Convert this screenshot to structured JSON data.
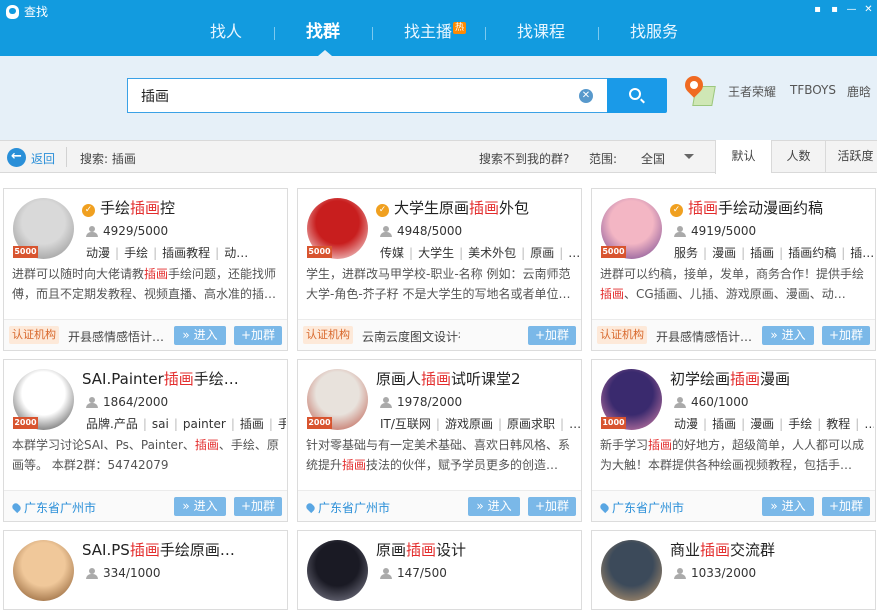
{
  "window": {
    "title": "查找"
  },
  "nav": {
    "tabs": [
      {
        "label": "找人"
      },
      {
        "label": "找群"
      },
      {
        "label": "找主播",
        "badge": "热"
      },
      {
        "label": "找课程"
      },
      {
        "label": "找服务"
      }
    ],
    "active": "找群"
  },
  "search": {
    "query": "插画",
    "clear_icon": "clear-icon",
    "button_icon": "search-icon"
  },
  "hot_words": [
    "王者荣耀",
    "TFBOYS",
    "鹿晗"
  ],
  "filter": {
    "back_label": "返回",
    "search_label": "搜索: 插画",
    "not_found": "搜索不到我的群?",
    "scope_label": "范围:",
    "scope_value": "全国",
    "sort_tabs": [
      "默认",
      "人数",
      "活跃度"
    ],
    "active_sort": "默认"
  },
  "buttons": {
    "enter": "» 进入",
    "join": "+加群",
    "org_badge": "认证机构"
  },
  "groups": [
    {
      "level": "5000",
      "certified": true,
      "title_pre": "手绘",
      "title_hl": "插画",
      "title_post": "控",
      "members": "4929/5000",
      "tags": [
        "动漫",
        "手绘",
        "插画教程",
        "动…"
      ],
      "desc_pre": "进群可以随时向大佬请教",
      "desc_hl": "插画",
      "desc_post": "手绘问题，还能找师傅，而且不定期发教程、视频直播、高水准的插…",
      "footer_type": "org",
      "footer_text": "开县感情感悟计…",
      "avatar_colors": [
        "#d9d9d9",
        "#8a8a8a"
      ]
    },
    {
      "level": "5000",
      "certified": true,
      "title_pre": "大学生原画",
      "title_hl": "插画",
      "title_post": "外包",
      "members": "4948/5000",
      "tags": [
        "传媒",
        "大学生",
        "美术外包",
        "原画",
        "…"
      ],
      "desc_pre": "学生，进群改马甲学校-职业-名称 例如：云南师范大学-角色-芥子籽 不是大学生的写地名或者单位…",
      "desc_hl": "",
      "desc_post": "",
      "footer_type": "org",
      "footer_text": "云南云度图文设计有限公司",
      "avatar_colors": [
        "#c81e1e",
        "#ffffff"
      ]
    },
    {
      "level": "5000",
      "certified": true,
      "title_pre": "",
      "title_hl": "插画",
      "title_post": "手绘动漫画约稿",
      "members": "4919/5000",
      "tags": [
        "服务",
        "漫画",
        "插画",
        "插画约稿",
        "插…"
      ],
      "desc_pre": "进群可以约稿，接单，发单，商务合作！提供手绘",
      "desc_hl": "插画",
      "desc_post": "、CG插画、儿插、游戏原画、漫画、动…",
      "footer_type": "org",
      "footer_text": "开县感情感悟计…",
      "avatar_colors": [
        "#f3b6c4",
        "#6a3d8c"
      ]
    },
    {
      "level": "2000",
      "certified": false,
      "title_pre": "SAI.Painter",
      "title_hl": "插画",
      "title_post": "手绘…",
      "members": "1864/2000",
      "tags": [
        "品牌.产品",
        "sai",
        "painter",
        "插画",
        "手…"
      ],
      "desc_pre": "本群学习讨论SAI、Ps、Painter、",
      "desc_hl": "插画",
      "desc_post": "、手绘、原画等。 本群2群：54742079",
      "footer_type": "loc",
      "footer_text": "广东省广州市",
      "avatar_colors": [
        "#ffffff",
        "#333333"
      ]
    },
    {
      "level": "2000",
      "certified": false,
      "title_pre": "原画人",
      "title_hl": "插画",
      "title_post": "试听课堂2",
      "members": "1978/2000",
      "tags": [
        "IT/互联网",
        "游戏原画",
        "原画求职",
        "…"
      ],
      "desc_pre": "针对零基础与有一定美术基础、喜欢日韩风格、系统提升",
      "desc_hl": "插画",
      "desc_post": "技法的伙伴，赋予学员更多的创造…",
      "footer_type": "loc",
      "footer_text": "广东省广州市",
      "avatar_colors": [
        "#e8e2dc",
        "#b84a3a"
      ]
    },
    {
      "level": "1000",
      "certified": false,
      "title_pre": "初学绘画",
      "title_hl": "插画",
      "title_post": "漫画",
      "members": "460/1000",
      "tags": [
        "动漫",
        "插画",
        "漫画",
        "手绘",
        "教程",
        "…"
      ],
      "desc_pre": "新手学习",
      "desc_hl": "插画",
      "desc_post": "的好地方，超级简单，人人都可以成为大触！本群提供各种绘画视频教程，包括手…",
      "footer_type": "loc",
      "footer_text": "广东省广州市",
      "avatar_colors": [
        "#3a2a6e",
        "#e58ab0"
      ]
    },
    {
      "level": "",
      "certified": false,
      "title_pre": "SAI.PS",
      "title_hl": "插画",
      "title_post": "手绘原画…",
      "members": "334/1000",
      "tags": [],
      "desc_pre": "",
      "desc_hl": "",
      "desc_post": "",
      "footer_type": "none",
      "footer_text": "",
      "avatar_colors": [
        "#f0c89a",
        "#7a4a20"
      ]
    },
    {
      "level": "",
      "certified": false,
      "title_pre": "原画",
      "title_hl": "插画",
      "title_post": "设计",
      "members": "147/500",
      "tags": [],
      "desc_pre": "",
      "desc_hl": "",
      "desc_post": "",
      "footer_type": "none",
      "footer_text": "",
      "avatar_colors": [
        "#1a1a24",
        "#8a8a9a"
      ]
    },
    {
      "level": "",
      "certified": false,
      "title_pre": "商业",
      "title_hl": "插画",
      "title_post": "交流群",
      "members": "1033/2000",
      "tags": [],
      "desc_pre": "",
      "desc_hl": "",
      "desc_post": "",
      "footer_type": "none",
      "footer_text": "",
      "avatar_colors": [
        "#3c4a5a",
        "#c8a070"
      ]
    }
  ]
}
